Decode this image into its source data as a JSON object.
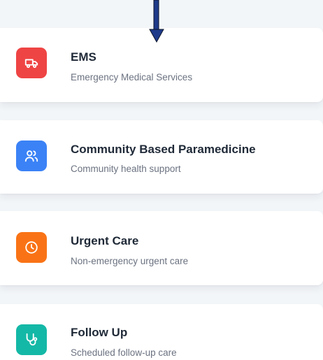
{
  "services": [
    {
      "title": "EMS",
      "subtitle": "Emergency Medical Services",
      "icon": "ambulance-icon",
      "color": "#ef4444"
    },
    {
      "title": "Community Based Paramedicine",
      "subtitle": "Community health support",
      "icon": "users-icon",
      "color": "#3b82f6"
    },
    {
      "title": "Urgent Care",
      "subtitle": "Non-emergency urgent care",
      "icon": "clock-icon",
      "color": "#f97316"
    },
    {
      "title": "Follow Up",
      "subtitle": "Scheduled follow-up care",
      "icon": "stethoscope-icon",
      "color": "#14b8a6"
    }
  ],
  "pointer": {
    "icon": "down-arrow-icon",
    "color": "#1e3a8a"
  }
}
